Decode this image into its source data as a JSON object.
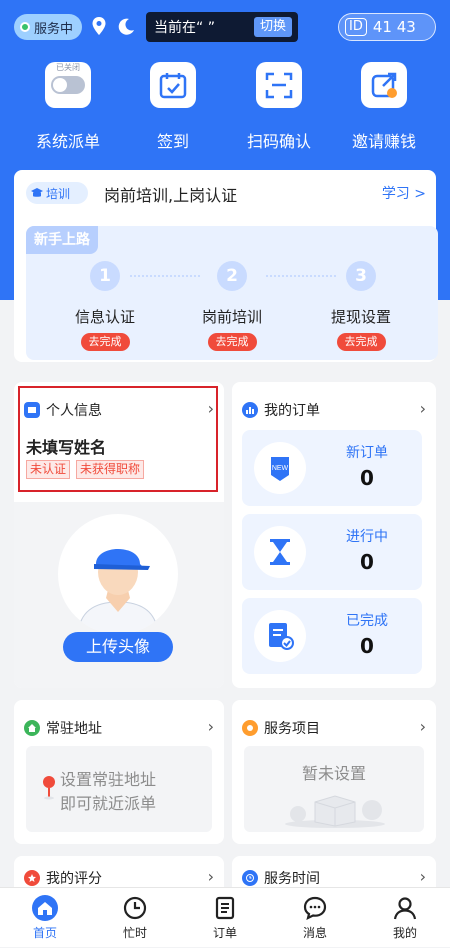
{
  "status": {
    "label": "服务中"
  },
  "location": {
    "text": "当前在“       ”",
    "switch_label": "切换"
  },
  "id_badge": {
    "tag": "ID",
    "value": "41     43"
  },
  "quick_actions": [
    {
      "label": "系统派单",
      "icon": "toggle-off-icon",
      "toggle_text": "已关闭"
    },
    {
      "label": "签到",
      "icon": "calendar-check-icon"
    },
    {
      "label": "扫码确认",
      "icon": "scan-icon"
    },
    {
      "label": "邀请赚钱",
      "icon": "share-coin-icon"
    }
  ],
  "training": {
    "tag": "培训",
    "title": "岗前培训,上岗认证",
    "action": "学习 >",
    "novice_label": "新手上路",
    "steps": [
      {
        "num": "1",
        "name": "信息认证",
        "button": "去完成"
      },
      {
        "num": "2",
        "name": "岗前培训",
        "button": "去完成"
      },
      {
        "num": "3",
        "name": "提现设置",
        "button": "去完成"
      }
    ]
  },
  "profile": {
    "title": "个人信息",
    "name": "未填写姓名",
    "badges": [
      "未认证",
      "未获得职称"
    ],
    "upload_label": "上传头像"
  },
  "orders": {
    "title": "我的订单",
    "items": [
      {
        "label": "新订单",
        "value": "0",
        "icon": "new-tag-icon"
      },
      {
        "label": "进行中",
        "value": "0",
        "icon": "hourglass-icon"
      },
      {
        "label": "已完成",
        "value": "0",
        "icon": "doc-check-icon"
      }
    ]
  },
  "address": {
    "title": "常驻地址",
    "line1": "设置常驻地址",
    "line2": "即可就近派单"
  },
  "service": {
    "title": "服务项目",
    "empty": "暂未设置"
  },
  "rating": {
    "title": "我的评分"
  },
  "service_time": {
    "title": "服务时间"
  },
  "tabs": [
    {
      "label": "首页",
      "active": true
    },
    {
      "label": "忙时"
    },
    {
      "label": "订单"
    },
    {
      "label": "消息"
    },
    {
      "label": "我的"
    }
  ],
  "colors": {
    "primary": "#2f74f6",
    "danger": "#f04b3b",
    "highlight_border": "#d8232a"
  }
}
